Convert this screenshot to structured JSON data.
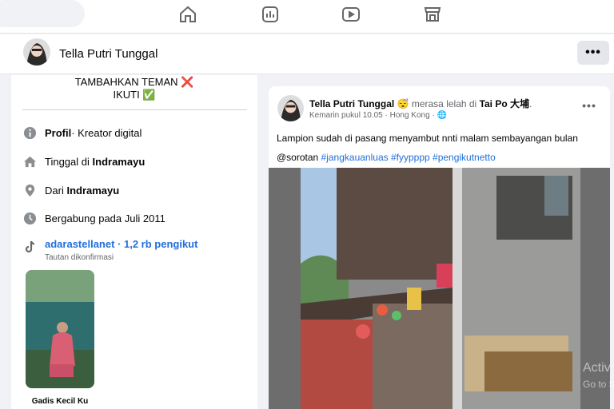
{
  "nav": {
    "icons": [
      "home-icon",
      "pages-icon",
      "video-icon",
      "marketplace-icon"
    ]
  },
  "profile": {
    "name": "Tella Putri Tunggal",
    "more_label": "•••"
  },
  "intro": {
    "bio_line1": "TAMBAHKAN TEMAN ❌",
    "bio_line2": "IKUTI ✅",
    "profile_label": "Profil",
    "profile_value": " · Kreator digital",
    "lives_prefix": "Tinggal di ",
    "lives_value": "Indramayu",
    "from_prefix": "Dari ",
    "from_value": "Indramayu",
    "joined": "Bergabung pada Juli 2011",
    "tiktok_link": "adarastellanet · 1,2 rb pengikut",
    "tiktok_sub": "Tautan dikonfirmasi",
    "featured_label": "Gadis Kecil Ku"
  },
  "post": {
    "author": "Tella Putri Tunggal",
    "feeling": " 😴 merasa lelah di ",
    "place": "Tai Po 大埔",
    "place_suffix": ".",
    "meta": "Kemarin pukul 10.05 · Hong Kong · 🌐",
    "more_label": "•••",
    "text_line1": "Lampion sudah di pasang menyambut nnti malam sembayangan bulan",
    "mention": "@sorotan ",
    "tags": [
      "#jangkauanluas",
      "#fyypppp",
      "#pengikutnetto"
    ]
  },
  "watermark": {
    "line1": "Activ",
    "line2": "Go to S"
  }
}
